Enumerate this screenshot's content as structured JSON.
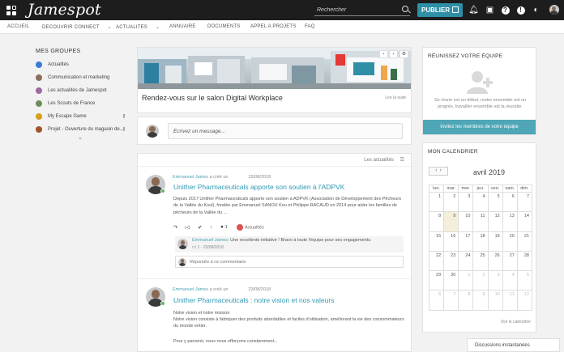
{
  "app": {
    "brand": "Jamespot",
    "accent": "#2e8fa7"
  },
  "search": {
    "placeholder": "Rechercher"
  },
  "toolbar": {
    "publish_label": "PUBLIER"
  },
  "nav": {
    "items": [
      "ACCUEIL",
      "DECOUVRIR CONNECT",
      "ACTUALITES",
      "ANNUAIRE",
      "DOCUMENTS",
      "APPEL A PROJETS",
      "FAQ"
    ]
  },
  "sidebar": {
    "title": "MES GROUPES",
    "groups": [
      {
        "label": "Actualités",
        "color": "#3a7bd5"
      },
      {
        "label": "Communication et marketing",
        "color": "#8c6d5a"
      },
      {
        "label": "Les actualités de Jamespot",
        "color": "#9a6aa0"
      },
      {
        "label": "Les Scouts de France",
        "color": "#6b8e5a"
      },
      {
        "label": "My Escape Game",
        "color": "#d4a017"
      },
      {
        "label": "Projet - Ouverture du magasin de...",
        "color": "#a0522d"
      }
    ]
  },
  "banner": {
    "title": "Rendez-vous sur le salon Digital Workplace",
    "link": "Lire la suite"
  },
  "compose": {
    "placeholder": "Écrivez un message..."
  },
  "feed": {
    "filter_label": "Les actualités",
    "posts": [
      {
        "author": "Emmanuel James",
        "verb": "a créé un",
        "date": "23/08/2018",
        "title": "Unither Pharmaceuticals apporte son soutien à l'ADPVK",
        "body": "Depuis 2017 Unither Pharmaceuticals apporte son soutien à ADPVK (Association de Développement des Pêcheurs de la Vallée du Koul), fondée par Emmanuel SANOU Kou et Philippe RACAUD en 2014 pour aider les familles de pêcheurs de la Vallée du ...",
        "comment_count": "1",
        "tag": "Actualités",
        "comment": {
          "author": "Emmanuel James",
          "text": ": Une excellente initiative ! Bravo à toute l'équipe pour ses engagements.",
          "likes": "1",
          "date": "23/08/2018"
        },
        "reply_placeholder": "Répondre à ce commentaire"
      },
      {
        "author": "Emmanuel James",
        "verb": "a créé un",
        "date": "23/08/2018",
        "title": "Unither Pharmaceuticals : notre vision et nos valeurs",
        "body1": "Notre vision et notre mission",
        "body2": "Notre vision consiste à fabriquer des produits abordables et faciles d'utilisation, améliorant la vie des consommateurs du monde entier.",
        "body3": "Pour y parvenir, nous nous efforçons constamment..."
      }
    ]
  },
  "team": {
    "title": "RÉUNISSEZ VOTRE ÉQUIPE",
    "text": "Se réunir est un début, rester ensemble est un progrès, travailler ensemble est la réussite.",
    "button": "Invitez les membres de votre équipe"
  },
  "calendar": {
    "title": "MON CALENDRIER",
    "month": "avril 2019",
    "days": [
      "lun.",
      "mar.",
      "mer.",
      "jeu.",
      "ven.",
      "sam.",
      "dim."
    ],
    "weeks": [
      [
        "1",
        "2",
        "3",
        "4",
        "5",
        "6",
        "7"
      ],
      [
        "8",
        "9",
        "10",
        "11",
        "12",
        "13",
        "14"
      ],
      [
        "15",
        "16",
        "17",
        "18",
        "19",
        "20",
        "21"
      ],
      [
        "22",
        "23",
        "24",
        "25",
        "26",
        "27",
        "28"
      ],
      [
        "29",
        "30",
        "1",
        "2",
        "3",
        "4",
        "5"
      ],
      [
        "6",
        "7",
        "8",
        "9",
        "10",
        "11",
        "12"
      ]
    ],
    "link": "Voir le calendrier"
  },
  "chat": {
    "label": "Discussions instantanées"
  }
}
